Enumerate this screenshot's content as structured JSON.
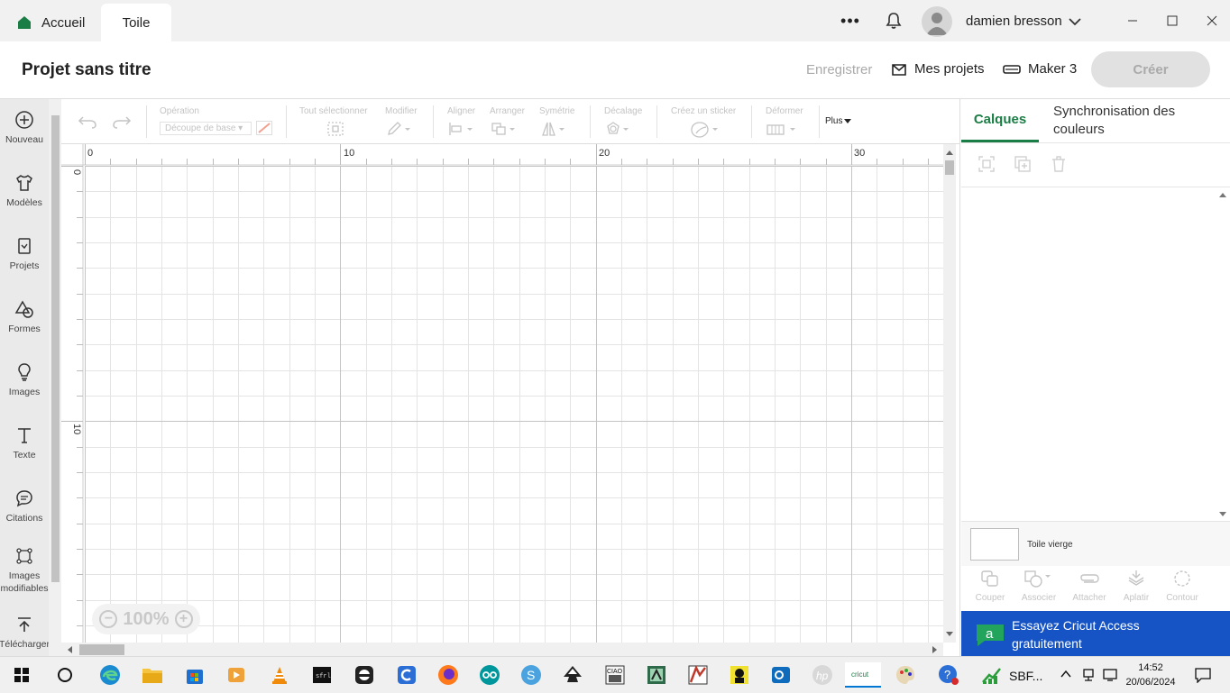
{
  "window": {
    "tabs": [
      {
        "label": "Accueil"
      },
      {
        "label": "Toile"
      }
    ],
    "more_label": "•••",
    "user_name": "damien bresson"
  },
  "header": {
    "project_title": "Projet sans titre",
    "save_label": "Enregistrer",
    "my_projects_label": "Mes projets",
    "machine_label": "Maker 3",
    "create_label": "Créer"
  },
  "sidebar": {
    "items": [
      {
        "label": "Nouveau",
        "icon": "plus-circle-icon"
      },
      {
        "label": "Modèles",
        "icon": "shirt-icon"
      },
      {
        "label": "Projets",
        "icon": "project-icon"
      },
      {
        "label": "Formes",
        "icon": "shapes-icon"
      },
      {
        "label": "Images",
        "icon": "lightbulb-icon"
      },
      {
        "label": "Texte",
        "icon": "text-icon"
      },
      {
        "label": "Citations",
        "icon": "quote-icon"
      },
      {
        "label": "Images modifiables",
        "icon": "editable-image-icon"
      },
      {
        "label": "Télécharger",
        "icon": "upload-icon"
      }
    ]
  },
  "toolbar": {
    "operation_label": "Opération",
    "operation_value": "Découpe de base",
    "select_all_label": "Tout sélectionner",
    "edit_label": "Modifier",
    "align_label": "Aligner",
    "arrange_label": "Arranger",
    "flip_label": "Symétrie",
    "offset_label": "Décalage",
    "sticker_label": "Créez un sticker",
    "warp_label": "Déformer",
    "more_label": "Plus"
  },
  "canvas": {
    "ruler_x_labels": [
      "0",
      "10",
      "20",
      "30"
    ],
    "ruler_y_labels": [
      "0",
      "10"
    ],
    "zoom_label": "100%"
  },
  "right_panel": {
    "tab_layers": "Calques",
    "tab_sync": "Synchronisation des couleurs",
    "blank_canvas_label": "Toile vierge",
    "bottom_tools": [
      {
        "label": "Couper"
      },
      {
        "label": "Associer"
      },
      {
        "label": "Attacher"
      },
      {
        "label": "Aplatir"
      },
      {
        "label": "Contour"
      }
    ],
    "promo_text": "Essayez Cricut Access gratuitement",
    "promo_color": "#1654c6"
  },
  "taskbar": {
    "sbf_label": "SBF...",
    "time": "14:52",
    "date": "20/06/2024"
  },
  "colors": {
    "accent": "#1a7d45",
    "create_disabled": "#e1e1e1"
  }
}
